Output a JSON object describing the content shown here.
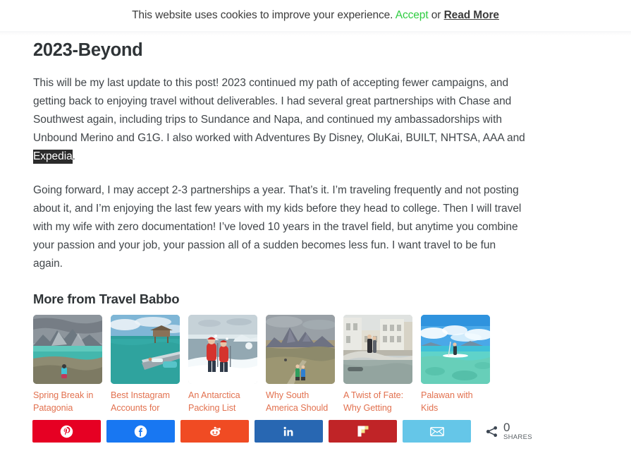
{
  "cookie_banner": {
    "message": "This website uses cookies to improve your experience.",
    "accept_label": "Accept",
    "separator": "or",
    "read_more_label": "Read More",
    "accept_color": "#2ecc40"
  },
  "article": {
    "heading": "2023-Beyond",
    "paragraph_1_before_selection": "This will be my last update to this post! 2023 continued my path of accepting fewer campaigns, and getting back to enjoying travel without deliverables. I had several great partnerships with Chase and Southwest again, including trips to Sundance and Napa, and continued my ambassadorships with Unbound Merino and G1G. I also worked with Adventures By Disney, OluKai, BUILT, NHTSA, AAA and ",
    "paragraph_1_selected_text": "Expedia",
    "paragraph_1_after_selection": ".",
    "paragraph_2": "Going forward, I may accept 2-3 partnerships a year. That’s it. I’m traveling frequently and not posting about it, and I’m enjoying the last few years with my kids before they head to college. Then I will travel with my wife with zero documentation! I’ve loved 10 years in the travel field, but anytime you combine your passion and your job, your passion all of a sudden becomes less fun. I want travel to be fun again."
  },
  "related": {
    "heading": "More from Travel Babbo",
    "items": [
      {
        "title": "Spring Break in Patagonia",
        "image_alt": "child sitting on rocks overlooking turquoise lake and jagged peaks in Patagonia"
      },
      {
        "title": "Best Instagram Accounts for Family Travel",
        "image_alt": "overwater bungalows above turquoise lagoon with pool deck"
      },
      {
        "title": "An Antarctica Packing List",
        "image_alt": "two people in red parkas and santa hats on ice with icebergs behind"
      },
      {
        "title": "Why South America Should Be Your Next",
        "image_alt": "two hikers on trail below granite mountain towers"
      },
      {
        "title": "A Twist of Fate: Why Getting Robbed in Spain",
        "image_alt": "couple on stone bridge over canal with old european buildings"
      },
      {
        "title": "Palawan with Kids",
        "image_alt": "person paddleboarding on clear turquoise water over coral"
      }
    ],
    "link_color": "#e2714f"
  },
  "share_bar": {
    "buttons": [
      {
        "name": "pinterest",
        "label": "Pinterest",
        "icon": "pinterest-icon",
        "color": "#e60023"
      },
      {
        "name": "facebook",
        "label": "Facebook",
        "icon": "facebook-icon",
        "color": "#1877f2"
      },
      {
        "name": "reddit",
        "label": "Reddit",
        "icon": "reddit-icon",
        "color": "#f04b23"
      },
      {
        "name": "linkedin",
        "label": "LinkedIn",
        "icon": "linkedin-icon",
        "color": "#2867b2"
      },
      {
        "name": "flipboard",
        "label": "Flipboard",
        "icon": "flipboard-icon",
        "color": "#c02427"
      },
      {
        "name": "email",
        "label": "Email",
        "icon": "envelope-icon",
        "color": "#65c6e8"
      }
    ],
    "share_icon": "share-nodes-icon",
    "count": "0",
    "count_label": "SHARES"
  }
}
